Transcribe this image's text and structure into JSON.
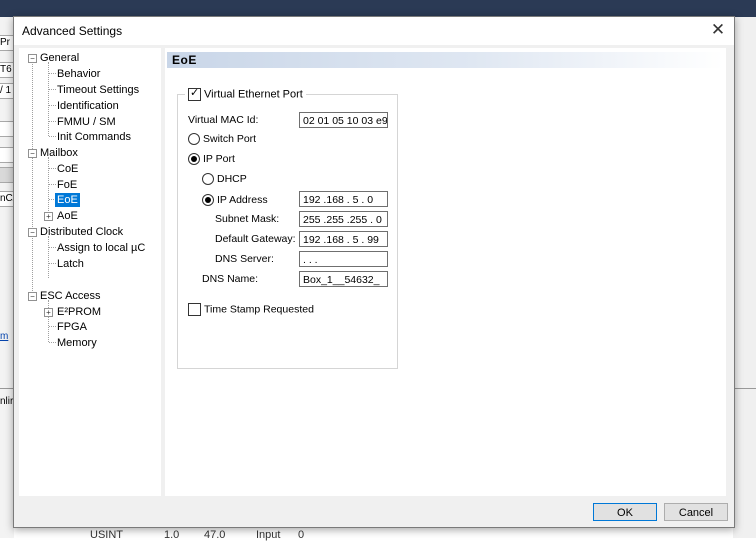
{
  "background": {
    "left_cells": [
      "Pr",
      "T6",
      "/ 1",
      "",
      "",
      "",
      "nC/",
      "",
      "m",
      "nlir"
    ],
    "bottom_row": [
      "USINT",
      "1.0",
      "47.0",
      "Input",
      "0"
    ]
  },
  "dialog": {
    "title": "Advanced Settings",
    "close_glyph": "✕"
  },
  "tree": {
    "general": "General",
    "behavior": "Behavior",
    "timeout_settings": "Timeout Settings",
    "identification": "Identification",
    "fmmu_sm": "FMMU / SM",
    "init_commands": "Init Commands",
    "mailbox": "Mailbox",
    "coe": "CoE",
    "foe": "FoE",
    "eoe": "EoE",
    "aoe": "AoE",
    "distributed_clock": "Distributed Clock",
    "assign_local": "Assign to local µC",
    "latch": "Latch",
    "esc_access": "ESC Access",
    "e2prom": "E²PROM",
    "fpga": "FPGA",
    "memory": "Memory",
    "minus": "−",
    "plus": "+"
  },
  "eoe": {
    "header": "EoE",
    "virtual_ethernet_port": "Virtual Ethernet Port",
    "virtual_ethernet_port_checked": true,
    "virtual_mac_label": "Virtual MAC Id:",
    "virtual_mac_value": "02 01 05 10 03 e9",
    "switch_port": "Switch Port",
    "ip_port": "IP Port",
    "ip_port_selected": true,
    "dhcp": "DHCP",
    "ip_address": "IP Address",
    "ip_address_selected": true,
    "ip_address_value": "192 .168 .  5  .  0",
    "subnet_mask_label": "Subnet Mask:",
    "subnet_mask_value": "255 .255 .255 .  0",
    "default_gateway_label": "Default Gateway:",
    "default_gateway_value": "192 .168 .  5  . 99",
    "dns_server_label": "DNS Server:",
    "dns_server_value": "      .      .      .",
    "dns_name_label": "DNS Name:",
    "dns_name_value": "Box_1__54632_",
    "time_stamp": "Time Stamp Requested",
    "time_stamp_checked": false
  },
  "buttons": {
    "ok": "OK",
    "cancel": "Cancel"
  }
}
